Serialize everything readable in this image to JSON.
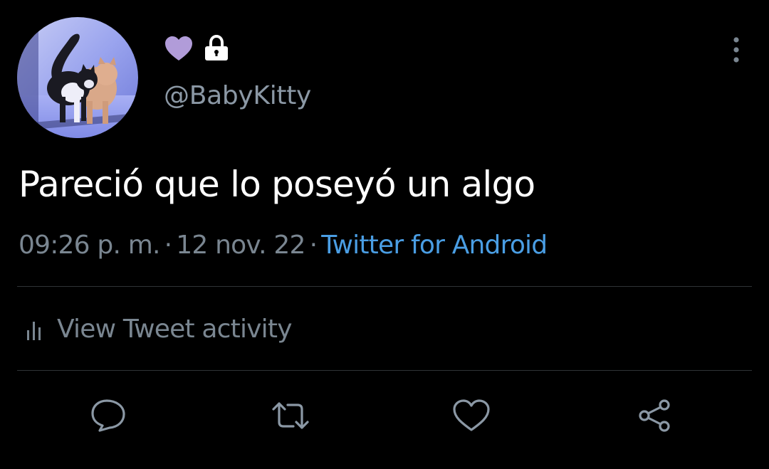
{
  "user": {
    "handle": "@BabyKitty",
    "avatar_icon": "cats-photo-avatar",
    "heart_color": "#b19cd9",
    "lock_icon": "lock-icon"
  },
  "tweet": {
    "text": "Pareció que lo poseyó un algo",
    "time": "09:26 p. m.",
    "date": "12 nov. 22",
    "source": "Twitter for Android",
    "separator": "·"
  },
  "activity": {
    "label": "View Tweet activity",
    "icon": "bar-chart-icon"
  },
  "actions": [
    {
      "name": "reply",
      "icon": "speech-bubble-icon"
    },
    {
      "name": "retweet",
      "icon": "retweet-icon"
    },
    {
      "name": "like",
      "icon": "heart-outline-icon"
    },
    {
      "name": "share",
      "icon": "share-icon"
    }
  ],
  "colors": {
    "background": "#000000",
    "text_primary": "#ffffff",
    "text_secondary": "#7a8691",
    "link": "#4a9ee4",
    "divider": "#2f3336"
  }
}
